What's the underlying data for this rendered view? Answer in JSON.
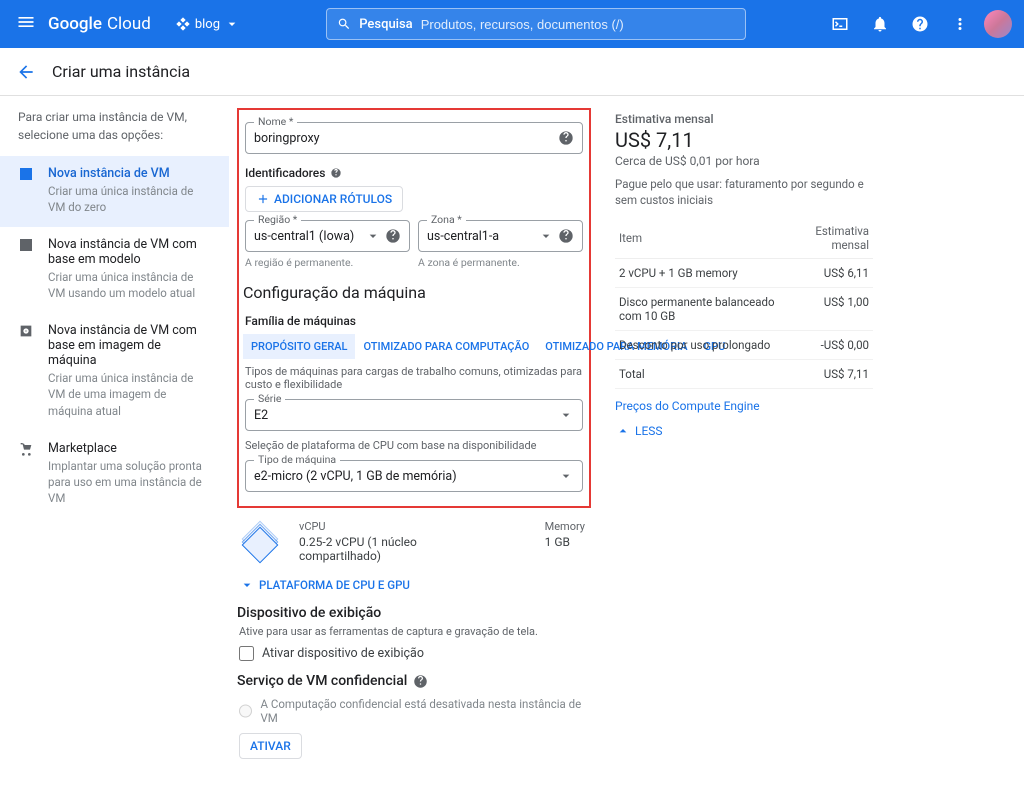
{
  "header": {
    "logo": {
      "brand": "Google",
      "product": "Cloud"
    },
    "project": "blog",
    "search_label": "Pesquisa",
    "search_placeholder": "Produtos, recursos, documentos (/)"
  },
  "page_title": "Criar uma instância",
  "sidebar": {
    "intro": "Para criar uma instância de VM, selecione uma das opções:",
    "items": [
      {
        "label": "Nova instância de VM",
        "sub": "Criar uma única instância de VM do zero",
        "selected": true,
        "icon": "plus-box-icon"
      },
      {
        "label": "Nova instância de VM com base em modelo",
        "sub": "Criar uma única instância de VM usando um modelo atual",
        "icon": "plus-box-icon"
      },
      {
        "label": "Nova instância de VM com base em imagem de máquina",
        "sub": "Criar uma única instância de VM de uma imagem de máquina atual",
        "icon": "disk-icon"
      },
      {
        "label": "Marketplace",
        "sub": "Implantar uma solução pronta para uso em uma instância de VM",
        "icon": "cart-icon"
      }
    ]
  },
  "form": {
    "name_label": "Nome *",
    "name_value": "boringproxy",
    "identifiers_label": "Identificadores",
    "add_labels_btn": "ADICIONAR RÓTULOS",
    "region_label": "Região *",
    "region_value": "us-central1 (Iowa)",
    "region_note": "A região é permanente.",
    "zone_label": "Zona *",
    "zone_value": "us-central1-a",
    "zone_note": "A zona é permanente.",
    "machine_config_heading": "Configuração da máquina",
    "family_label": "Família de máquinas",
    "family_tabs": [
      {
        "label": "PROPÓSITO GERAL",
        "active": true
      },
      {
        "label": "OTIMIZADO PARA COMPUTAÇÃO"
      },
      {
        "label": "OTIMIZADO PARA MEMÓRIA"
      },
      {
        "label": "GPU"
      }
    ],
    "family_note": "Tipos de máquinas para cargas de trabalho comuns, otimizadas para custo e flexibilidade",
    "series_label": "Série",
    "series_value": "E2",
    "series_note": "Seleção de plataforma de CPU com base na disponibilidade",
    "machine_type_label": "Tipo de máquina",
    "machine_type_value": "e2-micro (2 vCPU, 1 GB de memória)",
    "cpu_block": {
      "vcpu_header": "vCPU",
      "vcpu_value": "0.25-2 vCPU (1 núcleo compartilhado)",
      "mem_header": "Memory",
      "mem_value": "1 GB"
    },
    "platform_expander": "PLATAFORMA DE CPU E GPU",
    "display_heading": "Dispositivo de exibição",
    "display_note": "Ative para usar as ferramentas de captura e gravação de tela.",
    "display_checkbox": "Ativar dispositivo de exibição",
    "confidential_heading": "Serviço de VM confidencial",
    "confidential_note": "A Computação confidencial está desativada nesta instância de VM",
    "enable_btn": "ATIVAR"
  },
  "estimate": {
    "heading": "Estimativa mensal",
    "total_big": "US$ 7,11",
    "per_hour": "Cerca de US$ 0,01 por hora",
    "billing_note": "Pague pelo que usar: faturamento por segundo e sem custos iniciais",
    "col_item": "Item",
    "col_value": "Estimativa mensal",
    "rows": [
      {
        "item": "2 vCPU + 1 GB memory",
        "value": "US$ 6,11"
      },
      {
        "item": "Disco permanente balanceado com 10 GB",
        "value": "US$ 1,00"
      },
      {
        "item": "Desconto por uso prolongado",
        "value": "-US$ 0,00",
        "discount": true
      },
      {
        "item": "Total",
        "value": "US$ 7,11"
      }
    ],
    "prices_link": "Preços do Compute Engine",
    "less": "LESS"
  }
}
